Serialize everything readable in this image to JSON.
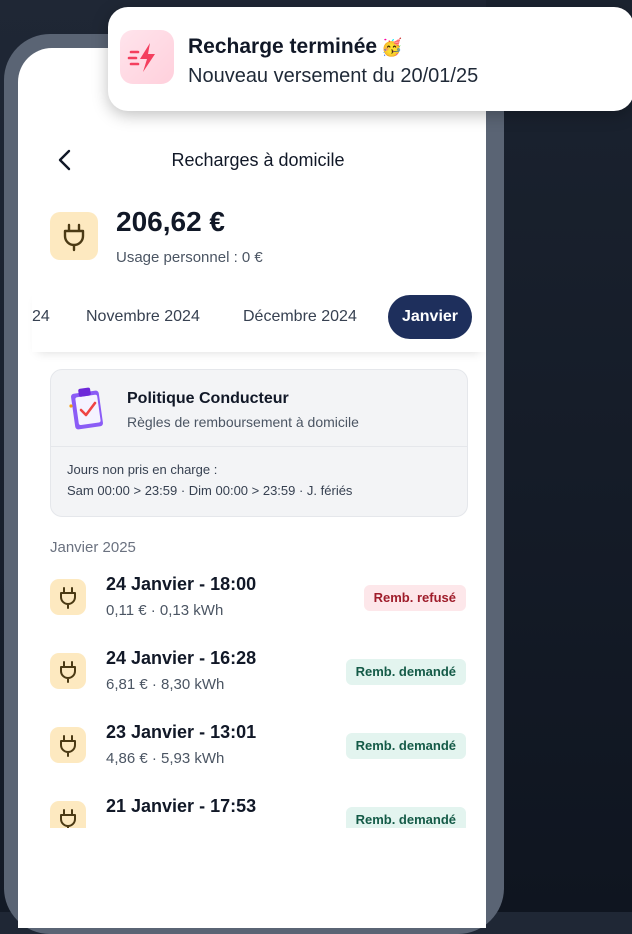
{
  "notification": {
    "title": "Recharge terminée",
    "emoji": "🥳",
    "body": "Nouveau versement du 20/01/25",
    "icon": "lightning-icon",
    "accent": "#f43f5e"
  },
  "header": {
    "title": "Recharges à domicile",
    "back_icon": "chevron-left-icon"
  },
  "summary": {
    "amount": "206,62 €",
    "personal_usage": "Usage personnel : 0 €",
    "icon": "plug-icon"
  },
  "tabs": [
    {
      "label": "24",
      "active": false
    },
    {
      "label": "Novembre 2024",
      "active": false
    },
    {
      "label": "Décembre 2024",
      "active": false
    },
    {
      "label": "Janvier",
      "active": true
    }
  ],
  "policy": {
    "title": "Politique Conducteur",
    "subtitle": "Règles de remboursement à domicile",
    "excluded_label": "Jours non pris en charge :",
    "excluded_detail": "Sam 00:00 > 23:59 · Dim 00:00 > 23:59 · J. fériés",
    "icon": "clipboard-check-icon"
  },
  "section": {
    "title": "Janvier 2025"
  },
  "charges": [
    {
      "title": "24 Janvier - 18:00",
      "detail": "0,11 € · 0,13 kWh",
      "status": "Remb. refusé",
      "status_type": "refused"
    },
    {
      "title": "24 Janvier - 16:28",
      "detail": "6,81 € · 8,30 kWh",
      "status": "Remb. demandé",
      "status_type": "requested"
    },
    {
      "title": "23 Janvier - 13:01",
      "detail": "4,86 € · 5,93 kWh",
      "status": "Remb. demandé",
      "status_type": "requested"
    },
    {
      "title": "21 Janvier - 17:53",
      "detail": "",
      "status": "Remb. demandé",
      "status_type": "requested"
    }
  ],
  "colors": {
    "primary": "#1e2f5c",
    "plug_bg": "#fde9c0",
    "refused_bg": "#fde7ea",
    "refused_text": "#9f1d2b",
    "requested_bg": "#e3f4ef",
    "requested_text": "#145a47"
  }
}
